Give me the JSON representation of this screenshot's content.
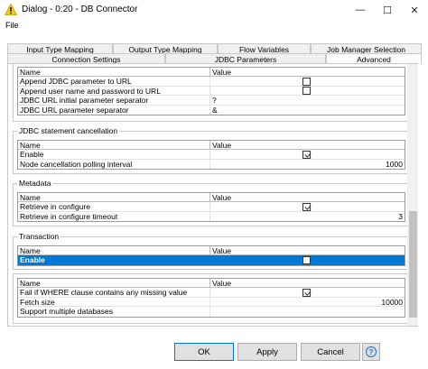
{
  "window": {
    "title": "Dialog - 0:20 - DB Connector",
    "minimize": "—",
    "maximize": "☐",
    "close": "✕"
  },
  "menu": {
    "file": "File"
  },
  "tabs_row1": [
    "Input Type Mapping",
    "Output Type Mapping",
    "Flow Variables",
    "Job Manager Selection"
  ],
  "tabs_row2": [
    "Connection Settings",
    "JDBC Parameters",
    "Advanced"
  ],
  "active_tab": "Advanced",
  "columns": {
    "name": "Name",
    "value": "Value"
  },
  "sections": {
    "url": {
      "rows": [
        {
          "name": "Append JDBC parameter to URL",
          "checked": false
        },
        {
          "name": "Append user name and password to URL",
          "checked": false
        },
        {
          "name": "JDBC URL initial parameter separator",
          "value": "?"
        },
        {
          "name": "JDBC URL parameter separator",
          "value": "&"
        }
      ]
    },
    "cancellation": {
      "title": "JDBC statement cancellation",
      "rows": [
        {
          "name": "Enable",
          "checked": true
        },
        {
          "name": "Node cancellation polling interval",
          "value": "1000"
        }
      ]
    },
    "metadata": {
      "title": "Metadata",
      "rows": [
        {
          "name": "Retrieve in configure",
          "checked": true
        },
        {
          "name": "Retrieve in configure timeout",
          "value": "3"
        }
      ]
    },
    "transaction": {
      "title": "Transaction",
      "rows": [
        {
          "name": "Enable",
          "checked": false,
          "selected": true
        }
      ]
    },
    "misc": {
      "rows": [
        {
          "name": "Fail if WHERE clause contains any missing value",
          "checked": true
        },
        {
          "name": "Fetch size",
          "value": "10000"
        },
        {
          "name": "Support multiple databases",
          "value": ""
        }
      ]
    }
  },
  "buttons": {
    "ok": "OK",
    "apply": "Apply",
    "cancel": "Cancel",
    "help": "?"
  },
  "colors": {
    "selection": "#0078d7",
    "warning": "#f5c518",
    "help": "#1a73c8"
  }
}
